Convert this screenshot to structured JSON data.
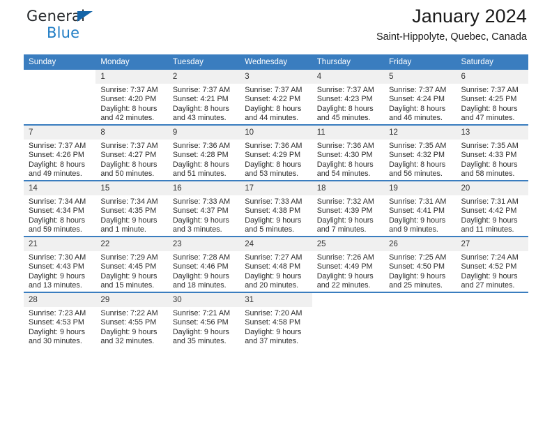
{
  "brand": {
    "name_part1": "General",
    "name_part2": "Blue",
    "accent_color": "#1f7cc4",
    "triangle_color": "#1565a8"
  },
  "header": {
    "title": "January 2024",
    "location": "Saint-Hippolyte, Quebec, Canada"
  },
  "calendar": {
    "header_bg": "#3a7dbf",
    "daynum_bg": "#f0f0f0",
    "weekdays": [
      "Sunday",
      "Monday",
      "Tuesday",
      "Wednesday",
      "Thursday",
      "Friday",
      "Saturday"
    ],
    "weeks": [
      [
        {
          "day": "",
          "sunrise": "",
          "sunset": "",
          "daylight1": "",
          "daylight2": ""
        },
        {
          "day": "1",
          "sunrise": "Sunrise: 7:37 AM",
          "sunset": "Sunset: 4:20 PM",
          "daylight1": "Daylight: 8 hours",
          "daylight2": "and 42 minutes."
        },
        {
          "day": "2",
          "sunrise": "Sunrise: 7:37 AM",
          "sunset": "Sunset: 4:21 PM",
          "daylight1": "Daylight: 8 hours",
          "daylight2": "and 43 minutes."
        },
        {
          "day": "3",
          "sunrise": "Sunrise: 7:37 AM",
          "sunset": "Sunset: 4:22 PM",
          "daylight1": "Daylight: 8 hours",
          "daylight2": "and 44 minutes."
        },
        {
          "day": "4",
          "sunrise": "Sunrise: 7:37 AM",
          "sunset": "Sunset: 4:23 PM",
          "daylight1": "Daylight: 8 hours",
          "daylight2": "and 45 minutes."
        },
        {
          "day": "5",
          "sunrise": "Sunrise: 7:37 AM",
          "sunset": "Sunset: 4:24 PM",
          "daylight1": "Daylight: 8 hours",
          "daylight2": "and 46 minutes."
        },
        {
          "day": "6",
          "sunrise": "Sunrise: 7:37 AM",
          "sunset": "Sunset: 4:25 PM",
          "daylight1": "Daylight: 8 hours",
          "daylight2": "and 47 minutes."
        }
      ],
      [
        {
          "day": "7",
          "sunrise": "Sunrise: 7:37 AM",
          "sunset": "Sunset: 4:26 PM",
          "daylight1": "Daylight: 8 hours",
          "daylight2": "and 49 minutes."
        },
        {
          "day": "8",
          "sunrise": "Sunrise: 7:37 AM",
          "sunset": "Sunset: 4:27 PM",
          "daylight1": "Daylight: 8 hours",
          "daylight2": "and 50 minutes."
        },
        {
          "day": "9",
          "sunrise": "Sunrise: 7:36 AM",
          "sunset": "Sunset: 4:28 PM",
          "daylight1": "Daylight: 8 hours",
          "daylight2": "and 51 minutes."
        },
        {
          "day": "10",
          "sunrise": "Sunrise: 7:36 AM",
          "sunset": "Sunset: 4:29 PM",
          "daylight1": "Daylight: 8 hours",
          "daylight2": "and 53 minutes."
        },
        {
          "day": "11",
          "sunrise": "Sunrise: 7:36 AM",
          "sunset": "Sunset: 4:30 PM",
          "daylight1": "Daylight: 8 hours",
          "daylight2": "and 54 minutes."
        },
        {
          "day": "12",
          "sunrise": "Sunrise: 7:35 AM",
          "sunset": "Sunset: 4:32 PM",
          "daylight1": "Daylight: 8 hours",
          "daylight2": "and 56 minutes."
        },
        {
          "day": "13",
          "sunrise": "Sunrise: 7:35 AM",
          "sunset": "Sunset: 4:33 PM",
          "daylight1": "Daylight: 8 hours",
          "daylight2": "and 58 minutes."
        }
      ],
      [
        {
          "day": "14",
          "sunrise": "Sunrise: 7:34 AM",
          "sunset": "Sunset: 4:34 PM",
          "daylight1": "Daylight: 8 hours",
          "daylight2": "and 59 minutes."
        },
        {
          "day": "15",
          "sunrise": "Sunrise: 7:34 AM",
          "sunset": "Sunset: 4:35 PM",
          "daylight1": "Daylight: 9 hours",
          "daylight2": "and 1 minute."
        },
        {
          "day": "16",
          "sunrise": "Sunrise: 7:33 AM",
          "sunset": "Sunset: 4:37 PM",
          "daylight1": "Daylight: 9 hours",
          "daylight2": "and 3 minutes."
        },
        {
          "day": "17",
          "sunrise": "Sunrise: 7:33 AM",
          "sunset": "Sunset: 4:38 PM",
          "daylight1": "Daylight: 9 hours",
          "daylight2": "and 5 minutes."
        },
        {
          "day": "18",
          "sunrise": "Sunrise: 7:32 AM",
          "sunset": "Sunset: 4:39 PM",
          "daylight1": "Daylight: 9 hours",
          "daylight2": "and 7 minutes."
        },
        {
          "day": "19",
          "sunrise": "Sunrise: 7:31 AM",
          "sunset": "Sunset: 4:41 PM",
          "daylight1": "Daylight: 9 hours",
          "daylight2": "and 9 minutes."
        },
        {
          "day": "20",
          "sunrise": "Sunrise: 7:31 AM",
          "sunset": "Sunset: 4:42 PM",
          "daylight1": "Daylight: 9 hours",
          "daylight2": "and 11 minutes."
        }
      ],
      [
        {
          "day": "21",
          "sunrise": "Sunrise: 7:30 AM",
          "sunset": "Sunset: 4:43 PM",
          "daylight1": "Daylight: 9 hours",
          "daylight2": "and 13 minutes."
        },
        {
          "day": "22",
          "sunrise": "Sunrise: 7:29 AM",
          "sunset": "Sunset: 4:45 PM",
          "daylight1": "Daylight: 9 hours",
          "daylight2": "and 15 minutes."
        },
        {
          "day": "23",
          "sunrise": "Sunrise: 7:28 AM",
          "sunset": "Sunset: 4:46 PM",
          "daylight1": "Daylight: 9 hours",
          "daylight2": "and 18 minutes."
        },
        {
          "day": "24",
          "sunrise": "Sunrise: 7:27 AM",
          "sunset": "Sunset: 4:48 PM",
          "daylight1": "Daylight: 9 hours",
          "daylight2": "and 20 minutes."
        },
        {
          "day": "25",
          "sunrise": "Sunrise: 7:26 AM",
          "sunset": "Sunset: 4:49 PM",
          "daylight1": "Daylight: 9 hours",
          "daylight2": "and 22 minutes."
        },
        {
          "day": "26",
          "sunrise": "Sunrise: 7:25 AM",
          "sunset": "Sunset: 4:50 PM",
          "daylight1": "Daylight: 9 hours",
          "daylight2": "and 25 minutes."
        },
        {
          "day": "27",
          "sunrise": "Sunrise: 7:24 AM",
          "sunset": "Sunset: 4:52 PM",
          "daylight1": "Daylight: 9 hours",
          "daylight2": "and 27 minutes."
        }
      ],
      [
        {
          "day": "28",
          "sunrise": "Sunrise: 7:23 AM",
          "sunset": "Sunset: 4:53 PM",
          "daylight1": "Daylight: 9 hours",
          "daylight2": "and 30 minutes."
        },
        {
          "day": "29",
          "sunrise": "Sunrise: 7:22 AM",
          "sunset": "Sunset: 4:55 PM",
          "daylight1": "Daylight: 9 hours",
          "daylight2": "and 32 minutes."
        },
        {
          "day": "30",
          "sunrise": "Sunrise: 7:21 AM",
          "sunset": "Sunset: 4:56 PM",
          "daylight1": "Daylight: 9 hours",
          "daylight2": "and 35 minutes."
        },
        {
          "day": "31",
          "sunrise": "Sunrise: 7:20 AM",
          "sunset": "Sunset: 4:58 PM",
          "daylight1": "Daylight: 9 hours",
          "daylight2": "and 37 minutes."
        },
        {
          "day": "",
          "sunrise": "",
          "sunset": "",
          "daylight1": "",
          "daylight2": ""
        },
        {
          "day": "",
          "sunrise": "",
          "sunset": "",
          "daylight1": "",
          "daylight2": ""
        },
        {
          "day": "",
          "sunrise": "",
          "sunset": "",
          "daylight1": "",
          "daylight2": ""
        }
      ]
    ]
  }
}
